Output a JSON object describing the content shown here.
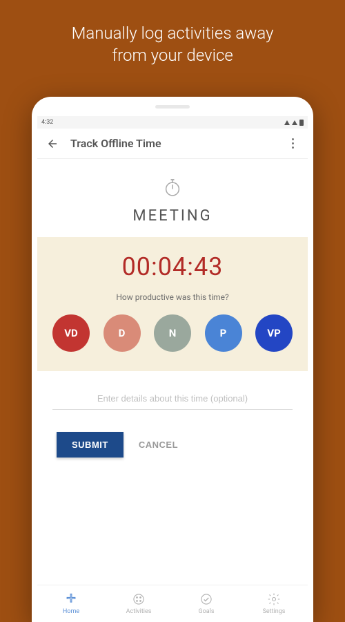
{
  "promo": {
    "line1": "Manually log activities away",
    "line2": "from your device"
  },
  "status": {
    "time": "4:32"
  },
  "appbar": {
    "title": "Track Offline Time"
  },
  "activity": {
    "name": "MEETING"
  },
  "timer": {
    "value": "00:04:43"
  },
  "prompt": "How productive was this time?",
  "ratings": {
    "vd": "VD",
    "d": "D",
    "n": "N",
    "p": "P",
    "vp": "VP"
  },
  "details": {
    "placeholder": "Enter details about this time (optional)"
  },
  "actions": {
    "submit": "SUBMIT",
    "cancel": "CANCEL"
  },
  "nav": {
    "home": "Home",
    "activities": "Activities",
    "goals": "Goals",
    "settings": "Settings"
  }
}
